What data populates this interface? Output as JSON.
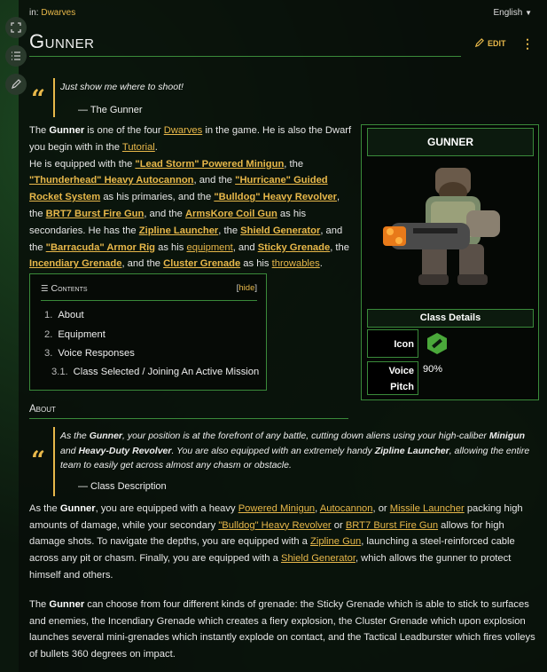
{
  "topbar": {
    "in_label": "in:",
    "category": "Dwarves",
    "language": "English"
  },
  "page": {
    "title": "Gunner",
    "edit_label": "EDIT"
  },
  "quote1": {
    "text": "Just show me where to shoot!",
    "cite": "— The Gunner"
  },
  "intro": {
    "p1": "The ",
    "gunner": "Gunner",
    "p2": " is one of the four ",
    "dwarves": "Dwarves",
    "p3": " in the game. He is also the Dwarf you begin with in the ",
    "tutorial": "Tutorial",
    "p4": ".",
    "p5": "He is equipped with the ",
    "minigun": "\"Lead Storm\" Powered Minigun",
    "p6": ", the ",
    "autocannon": "\"Thunderhead\" Heavy Autocannon",
    "p7": ", and the ",
    "rocket": "\"Hurricane\" Guided Rocket System",
    "p8": " as his primaries, and the ",
    "revolver": "\"Bulldog\" Heavy Revolver",
    "p9": ", the ",
    "burst": "BRT7 Burst Fire Gun",
    "p10": ", and the ",
    "coil": "ArmsKore Coil Gun",
    "p11": " as his secondaries. He has the ",
    "zipline": "Zipline Launcher",
    "p12": ", the ",
    "shield": "Shield Generator",
    "p13": ", and the ",
    "armor": "\"Barracuda\" Armor Rig",
    "p14": " as his ",
    "equipment": "equipment",
    "p15": ", and ",
    "sticky": "Sticky Grenade",
    "p16": ", the ",
    "incendiary": "Incendiary Grenade",
    "p17": ", and the ",
    "cluster": "Cluster Grenade",
    "p18": " as his ",
    "throwables": "throwables",
    "p19": "."
  },
  "infobox": {
    "title": "GUNNER",
    "section": "Class Details",
    "icon_label": "Icon",
    "voice_label_1": "Voice",
    "voice_label_2": "Pitch",
    "voice_value": "90%",
    "accent": "#3a8a3a"
  },
  "toc": {
    "title": "Contents",
    "hide_open": "[",
    "hide": "hide",
    "hide_close": "]",
    "items": [
      {
        "num": "1.",
        "label": "About"
      },
      {
        "num": "2.",
        "label": "Equipment"
      },
      {
        "num": "3.",
        "label": "Voice Responses"
      },
      {
        "num": "3.1.",
        "label": "Class Selected / Joining An Active Mission"
      }
    ]
  },
  "about": {
    "heading": "About",
    "q1": "As the ",
    "q_gunner": "Gunner",
    "q2": ", your position is at the forefront of any battle, cutting down aliens using your high-caliber ",
    "q_minigun": "Minigun",
    "q3": " and ",
    "q_revolver": "Heavy-Duty Revolver",
    "q4": ". You are also equipped with an extremely handy ",
    "q_zipline": "Zipline Launcher",
    "q5": ", allowing the entire team to easily get across almost any chasm or obstacle.",
    "cite": "— Class Description",
    "a1": "As the ",
    "a_gunner": "Gunner",
    "a2": ", you are equipped with a heavy ",
    "a_minigun": "Powered Minigun",
    "a3": ", ",
    "a_autocannon": "Autocannon",
    "a4": ", or ",
    "a_missile": "Missile Launcher",
    "a5": " packing high amounts of damage, while your secondary ",
    "a_revolver": "\"Bulldog\" Heavy Revolver",
    "a6": " or ",
    "a_burst": "BRT7 Burst Fire Gun",
    "a7": " allows for high damage shots. To navigate the depths, you are equipped with a ",
    "a_zipline": "Zipline Gun",
    "a8": ", launching a steel-reinforced cable across any pit or chasm. Finally, you are equipped with a ",
    "a_shield": "Shield Generator",
    "a9": ", which allows the gunner to protect himself and others.",
    "b1": "The ",
    "b_gunner": "Gunner",
    "b2": " can choose from four different kinds of grenade: the Sticky Grenade which is able to stick to surfaces and enemies, the Incendiary Grenade which creates a fiery explosion, the Cluster Grenade which upon explosion launches several mini-grenades which instantly explode on contact, and the Tactical Leadburster which fires volleys of bullets 360 degrees on impact."
  }
}
